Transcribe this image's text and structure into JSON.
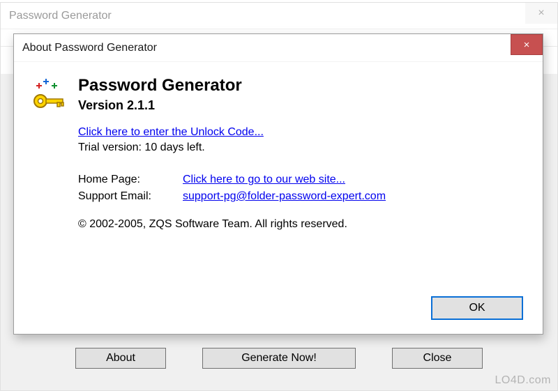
{
  "main": {
    "title": "Password Generator",
    "buttons": {
      "about": "About",
      "generate": "Generate Now!",
      "close": "Close"
    },
    "close_glyph": "×"
  },
  "about": {
    "title": "About Password Generator",
    "close_glyph": "×",
    "app_name": "Password Generator",
    "version_label": "Version 2.1.1",
    "unlock_link": "Click here to enter the Unlock Code...",
    "trial_text": "Trial version: 10 days left.",
    "homepage_label": "Home Page:",
    "homepage_link": "Click here to go to our web site...",
    "support_label": "Support Email:",
    "support_link": "support-pg@folder-password-expert.com",
    "copyright": "© 2002-2005, ZQS Software Team. All rights reserved.",
    "ok_label": "OK"
  },
  "watermark": "LO4D.com"
}
